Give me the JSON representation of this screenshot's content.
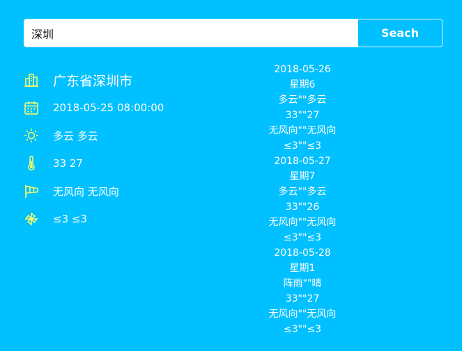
{
  "search": {
    "value": "深圳",
    "button_label": "Seach"
  },
  "current": {
    "city": "广东省深圳市",
    "datetime": "2018-05-25 08:00:00",
    "weather": "多云 多云",
    "temperature": "33 27",
    "wind_direction": "无风向 无风向",
    "wind_power": "≤3 ≤3",
    "icons": [
      "city-buildings-icon",
      "calendar-icon",
      "sun-icon",
      "thermometer-icon",
      "windsock-icon",
      "pinwheel-icon"
    ]
  },
  "forecast": [
    {
      "date": "2018-05-26",
      "week": "星期6",
      "weather": "多云\"\"多云",
      "temp": "33\"\"27",
      "wind": "无风向\"\"无风向",
      "power": "≤3\"\"≤3"
    },
    {
      "date": "2018-05-27",
      "week": "星期7",
      "weather": "多云\"\"多云",
      "temp": "33\"\"26",
      "wind": "无风向\"\"无风向",
      "power": "≤3\"\"≤3"
    },
    {
      "date": "2018-05-28",
      "week": "星期1",
      "weather": "阵雨\"\"晴",
      "temp": "33\"\"27",
      "wind": "无风向\"\"无风向",
      "power": "≤3\"\"≤3"
    }
  ],
  "colors": {
    "background": "#00c0ff",
    "icon": "#ffff66",
    "text": "#ffffff"
  }
}
